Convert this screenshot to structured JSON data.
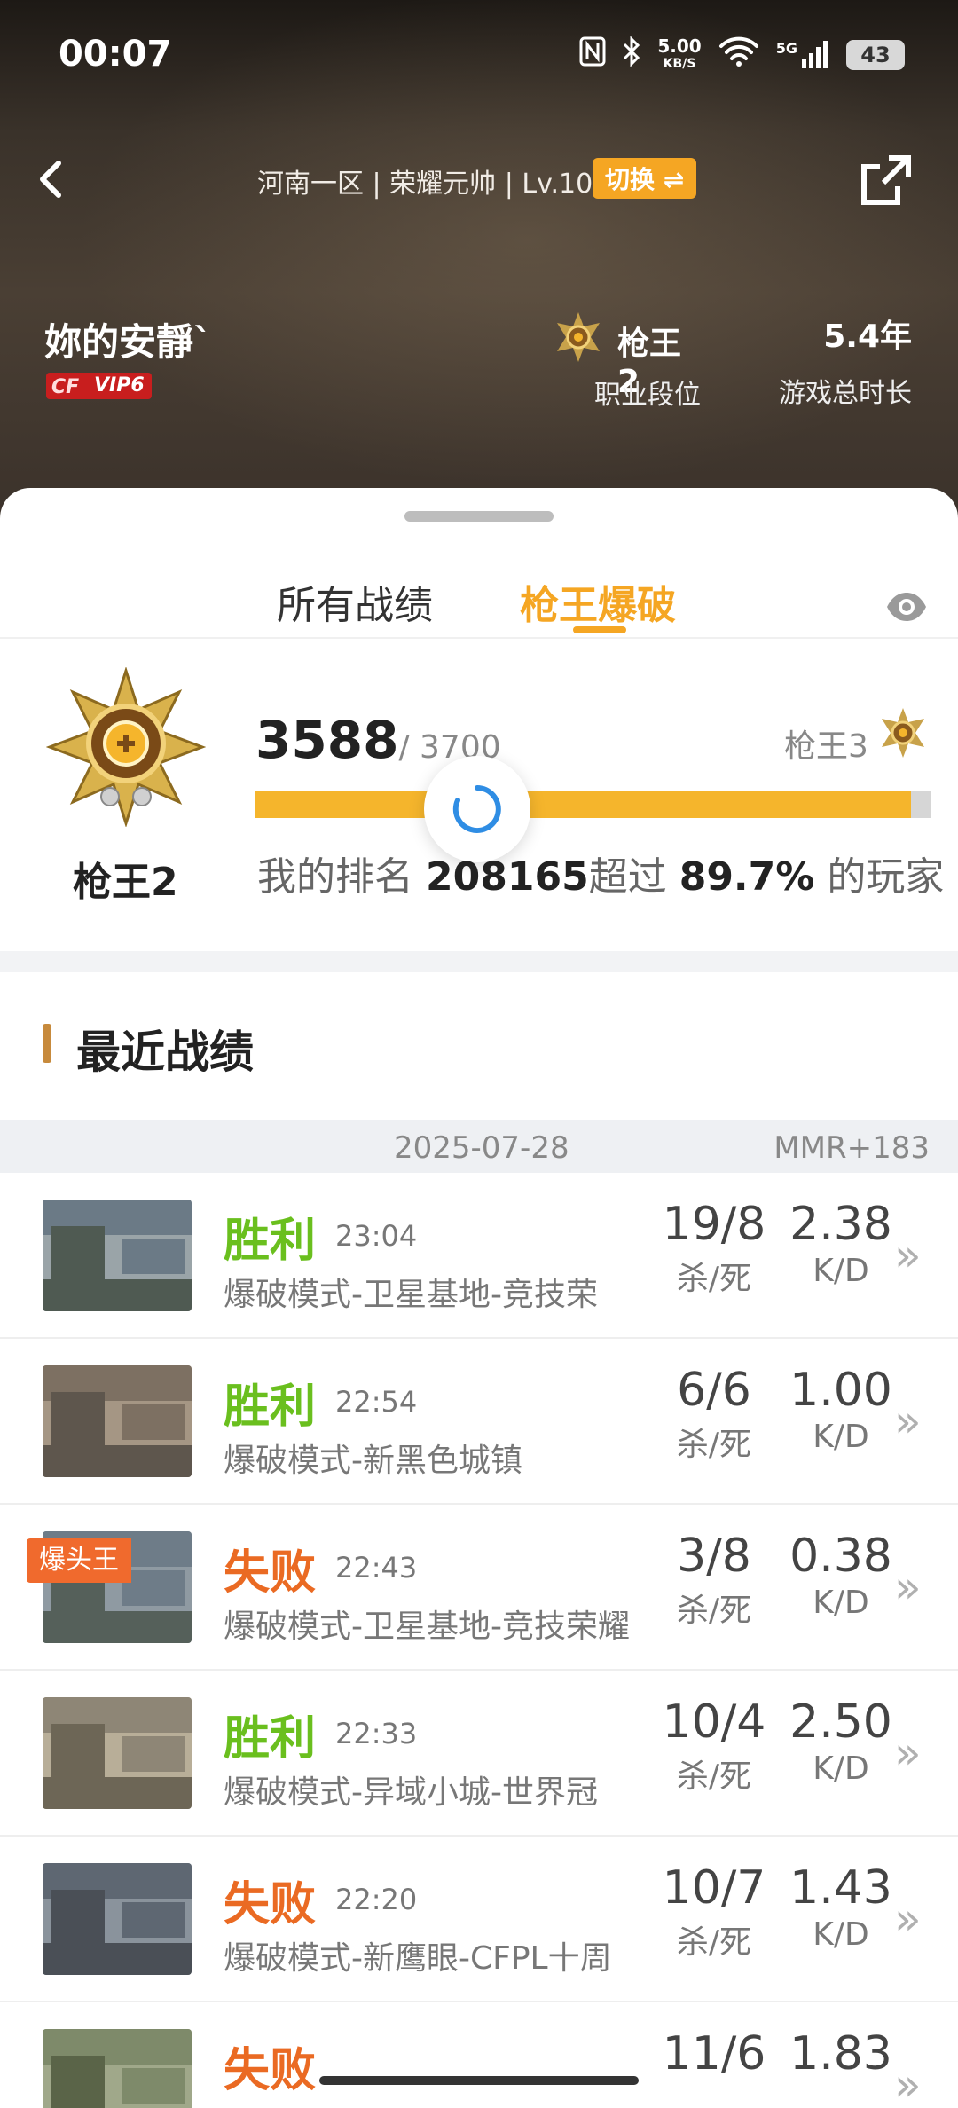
{
  "status_bar": {
    "time": "00:07",
    "net_speed": "5.00",
    "net_unit": "KB/S",
    "signal": "5G",
    "battery": "43"
  },
  "topbar": {
    "server": "河南一区 | 荣耀元帅 | Lv.102",
    "switch_label": "切换 ⇌"
  },
  "profile": {
    "nickname": "妳的安靜`",
    "vip": "VIP6",
    "vip_prefix": "CF",
    "rank_name": "枪王2",
    "rank_label": "职业段位",
    "play_time": "5.4年",
    "play_time_label": "游戏总时长"
  },
  "tabs": {
    "all": "所有战绩",
    "active": "枪王爆破"
  },
  "rank_card": {
    "rank_name": "枪王2",
    "score": "3588",
    "score_total": "/ 3700",
    "score_value": 3588,
    "score_max": 3700,
    "next_rank": "枪王3",
    "ranking_prefix": "我的排名",
    "ranking_number": "208165",
    "ranking_mid": "超过",
    "ranking_percent": "89.7%",
    "ranking_suffix": "的玩家"
  },
  "section": {
    "title": "最近战绩"
  },
  "date_row": {
    "date": "2025-07-28",
    "mmr": "MMR+183"
  },
  "matches": [
    {
      "result": "胜利",
      "win": true,
      "time": "23:04",
      "mode": "爆破模式-卫星基地-竞技荣",
      "kd": "19/8",
      "kd_label": "杀/死",
      "ratio": "2.38",
      "ratio_label": "K/D",
      "badge": ""
    },
    {
      "result": "胜利",
      "win": true,
      "time": "22:54",
      "mode": "爆破模式-新黑色城镇",
      "kd": "6/6",
      "kd_label": "杀/死",
      "ratio": "1.00",
      "ratio_label": "K/D",
      "badge": ""
    },
    {
      "result": "失败",
      "win": false,
      "time": "22:43",
      "mode": "爆破模式-卫星基地-竞技荣耀",
      "kd": "3/8",
      "kd_label": "杀/死",
      "ratio": "0.38",
      "ratio_label": "K/D",
      "badge": "爆头王"
    },
    {
      "result": "胜利",
      "win": true,
      "time": "22:33",
      "mode": "爆破模式-异域小城-世界冠",
      "kd": "10/4",
      "kd_label": "杀/死",
      "ratio": "2.50",
      "ratio_label": "K/D",
      "badge": ""
    },
    {
      "result": "失败",
      "win": false,
      "time": "22:20",
      "mode": "爆破模式-新鹰眼-CFPL十周",
      "kd": "10/7",
      "kd_label": "杀/死",
      "ratio": "1.43",
      "ratio_label": "K/D",
      "badge": ""
    },
    {
      "result": "失败",
      "win": false,
      "time": "",
      "mode": "",
      "kd": "11/6",
      "kd_label": "",
      "ratio": "1.83",
      "ratio_label": "",
      "badge": ""
    }
  ],
  "colors": {
    "accent": "#f5a623",
    "win": "#6abf1e",
    "lose": "#ea6a23",
    "header_bg": "#3a322a"
  },
  "icons": {
    "back": "chevron-left-icon",
    "share": "share-icon",
    "eye": "eye-icon",
    "chevron": "chevron-right-icon",
    "spinner": "loading-icon"
  }
}
